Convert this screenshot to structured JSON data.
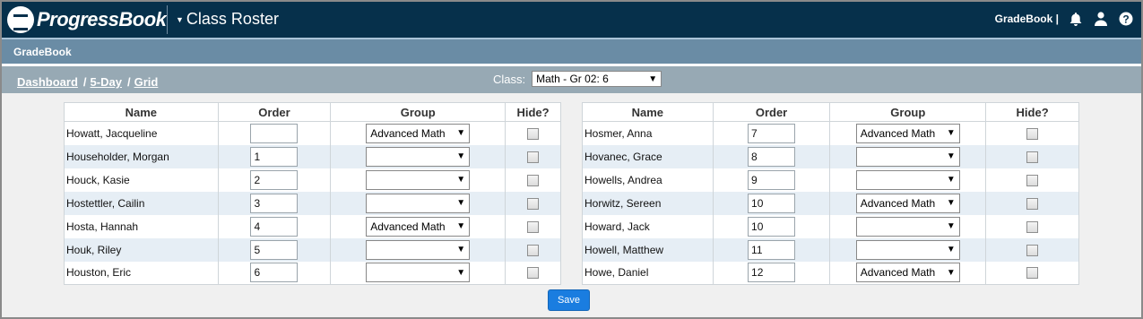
{
  "header": {
    "brand": "ProgressBook",
    "app_title": "Class Roster",
    "user_label": "GradeBook",
    "separator": "|",
    "icons": [
      "bell-icon",
      "user-icon",
      "help-icon"
    ]
  },
  "subbar": {
    "label": "GradeBook"
  },
  "breadcrumb": [
    {
      "label": "Dashboard"
    },
    {
      "label": "5-Day"
    },
    {
      "label": "Grid"
    }
  ],
  "class_selector": {
    "label": "Class:",
    "value": "Math - Gr 02: 6"
  },
  "columns": {
    "name": "Name",
    "order": "Order",
    "group": "Group",
    "hide": "Hide?"
  },
  "left_students": [
    {
      "name": "Howatt, Jacqueline",
      "order": "",
      "group": "Advanced Math",
      "hidden": false
    },
    {
      "name": "Householder, Morgan",
      "order": "1",
      "group": "",
      "hidden": false
    },
    {
      "name": "Houck, Kasie",
      "order": "2",
      "group": "",
      "hidden": false
    },
    {
      "name": "Hostettler, Cailin",
      "order": "3",
      "group": "",
      "hidden": false
    },
    {
      "name": "Hosta, Hannah",
      "order": "4",
      "group": "Advanced Math",
      "hidden": false
    },
    {
      "name": "Houk, Riley",
      "order": "5",
      "group": "",
      "hidden": false
    },
    {
      "name": "Houston, Eric",
      "order": "6",
      "group": "",
      "hidden": false
    }
  ],
  "right_students": [
    {
      "name": "Hosmer, Anna",
      "order": "7",
      "group": "Advanced Math",
      "hidden": false
    },
    {
      "name": "Hovanec, Grace",
      "order": "8",
      "group": "",
      "hidden": false
    },
    {
      "name": "Howells, Andrea",
      "order": "9",
      "group": "",
      "hidden": false
    },
    {
      "name": "Horwitz, Sereen",
      "order": "10",
      "group": "Advanced Math",
      "hidden": false
    },
    {
      "name": "Howard, Jack",
      "order": "10",
      "group": "",
      "hidden": false
    },
    {
      "name": "Howell, Matthew",
      "order": "11",
      "group": "",
      "hidden": false
    },
    {
      "name": "Howe, Daniel",
      "order": "12",
      "group": "Advanced Math",
      "hidden": false
    }
  ],
  "save_label": "Save",
  "colors": {
    "topbar": "#06304b",
    "subbar": "#6a8ca5",
    "navbar": "#97a9b4",
    "row_alt": "#e6eef5",
    "save_button": "#1a7de0"
  }
}
